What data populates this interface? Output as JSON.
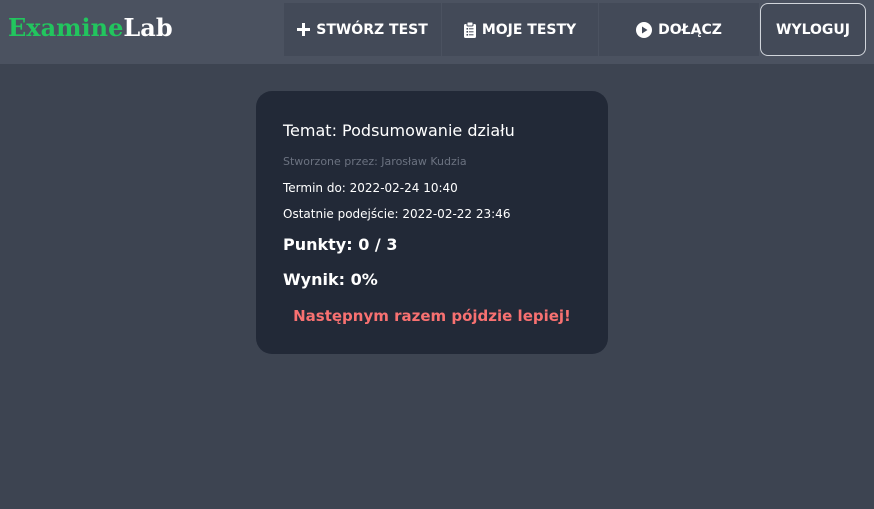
{
  "app": {
    "logo_part1": "Examine",
    "logo_part2": "Lab"
  },
  "nav": {
    "create_test": "STWÓRZ TEST",
    "my_tests": "MOJE TESTY",
    "join": "DOŁĄCZ",
    "logout": "WYLOGUJ"
  },
  "icons": {
    "create_test": "plus-icon",
    "my_tests": "clipboard-list-icon",
    "join": "play-circle-icon"
  },
  "result": {
    "topic": "Temat: Podsumowanie działu",
    "author": "Stworzone przez: Jarosław Kudzia",
    "deadline": "Termin do: 2022-02-24 10:40",
    "last_attempt": "Ostatnie podejście: 2022-02-22 23:46",
    "points": "Punkty: 0 / 3",
    "score": "Wynik: 0%",
    "message": "Następnym razem pójdzie lepiej!"
  },
  "colors": {
    "background": "#3d4451",
    "navbar": "#4b5260",
    "card": "#222937",
    "logo_accent": "#22c55e",
    "message": "#f87171",
    "author_text": "#6b7280"
  }
}
